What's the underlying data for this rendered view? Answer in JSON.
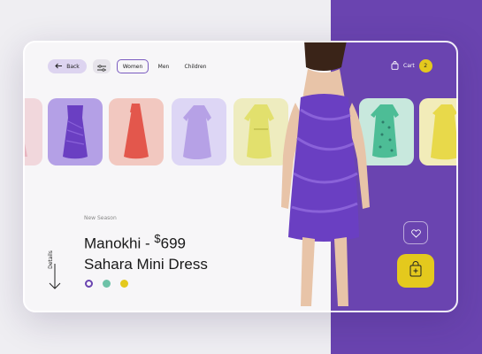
{
  "nav": {
    "back_label": "Back",
    "tabs": [
      {
        "label": "Women",
        "active": true
      },
      {
        "label": "Men",
        "active": false
      },
      {
        "label": "Children",
        "active": false
      }
    ],
    "cart_label": "Cart",
    "cart_count": "2"
  },
  "product": {
    "season": "New Season",
    "name_line1": "Manokhi -",
    "price_symbol": "$",
    "price": "699",
    "name_line2": "Sahara Mini Dress",
    "details_label": "Details"
  },
  "carousel": [
    {
      "name": "pink dress",
      "bg": "#f1d7dc",
      "dress": "#e8b4bf"
    },
    {
      "name": "purple leather dress",
      "bg": "#b4a0e6",
      "dress": "#6a3fc2",
      "selected": true
    },
    {
      "name": "red satin dress",
      "bg": "#f2c8c0",
      "dress": "#e3574c"
    },
    {
      "name": "lilac dress",
      "bg": "#ddd6f5",
      "dress": "#b6a1e6"
    },
    {
      "name": "yellow dress",
      "bg": "#eeecbf",
      "dress": "#e2e06d"
    },
    {
      "name": "green patterned dress",
      "bg": "#c8e8dd",
      "dress": "#4dbd96"
    },
    {
      "name": "yellow shift dress",
      "bg": "#f2ecb9",
      "dress": "#e8d94a"
    }
  ],
  "colors": {
    "accent": "#6a44b0",
    "yellow": "#e4c91d",
    "swatches": [
      "#6a44b0",
      "#6ec2a8",
      "#e4c91d"
    ]
  },
  "icons": [
    "arrow-left-icon",
    "filter-icon",
    "bag-icon",
    "heart-icon",
    "bag-plus-icon",
    "arrow-down-icon"
  ]
}
